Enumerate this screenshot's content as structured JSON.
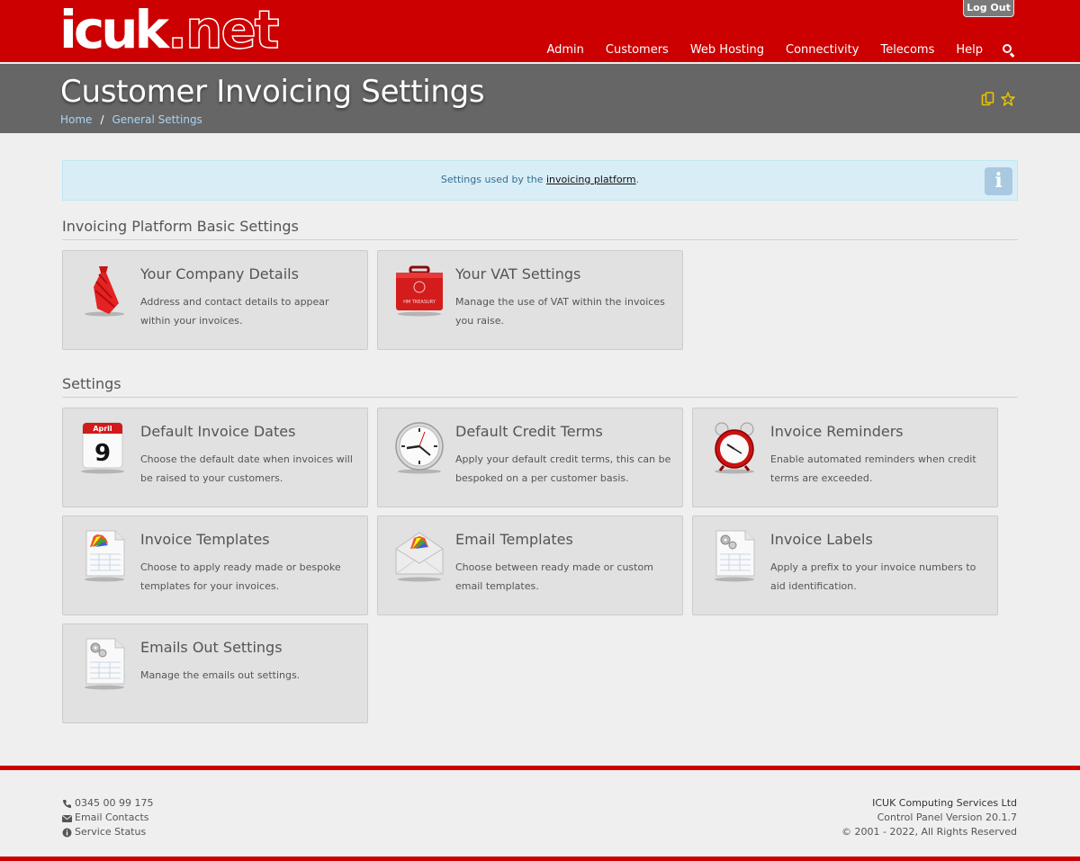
{
  "header": {
    "logo_main": "icuk",
    "logo_suffix": ".net",
    "logout_label": "Log Out",
    "nav": [
      "Admin",
      "Customers",
      "Web Hosting",
      "Connectivity",
      "Telecoms",
      "Help"
    ],
    "search_icon": "search-icon",
    "brand_color": "#cc0000"
  },
  "titlebar": {
    "title": "Customer Invoicing Settings",
    "breadcrumb": [
      "Home",
      "General Settings"
    ],
    "breadcrumb_separator": "/",
    "icons": [
      "copy-icon",
      "star-icon"
    ]
  },
  "info": {
    "text_before": "Settings used by the ",
    "link": "invoicing platform",
    "text_after": ".",
    "icon": "info-icon"
  },
  "sections": [
    {
      "heading": "Invoicing Platform Basic Settings",
      "cards": [
        {
          "title": "Your Company Details",
          "desc": "Address and contact details to appear within your invoices.",
          "icon": "tie-icon"
        },
        {
          "title": "Your VAT Settings",
          "desc": "Manage the use of VAT within the invoices you raise.",
          "icon": "treasury-case-icon",
          "icon_label": "HM TREASURY"
        }
      ]
    },
    {
      "heading": "Settings",
      "cards": [
        {
          "title": "Default Invoice Dates",
          "desc": "Choose the default date when invoices will be raised to your customers.",
          "icon": "calendar-icon",
          "icon_month": "April",
          "icon_day": "9"
        },
        {
          "title": "Default Credit Terms",
          "desc": "Apply your default credit terms, this can be bespoked on a per customer basis.",
          "icon": "clock-icon"
        },
        {
          "title": "Invoice Reminders",
          "desc": "Enable automated reminders when credit terms are exceeded.",
          "icon": "alarm-clock-icon"
        },
        {
          "title": "Invoice Templates",
          "desc": "Choose to apply ready made or bespoke templates for your invoices.",
          "icon": "colour-document-icon"
        },
        {
          "title": "Email Templates",
          "desc": "Choose between ready made or custom email templates.",
          "icon": "colour-envelope-icon"
        },
        {
          "title": "Invoice Labels",
          "desc": "Apply a prefix to your invoice numbers to aid identification.",
          "icon": "gear-document-icon"
        },
        {
          "title": "Emails Out Settings",
          "desc": "Manage the emails out settings.",
          "icon": "gear-document-icon"
        }
      ]
    }
  ],
  "footer": {
    "phone": "0345 00 99 175",
    "email": "Email Contacts",
    "status": "Service Status",
    "company": "ICUK Computing Services Ltd",
    "version": "Control Panel Version 20.1.7",
    "copyright": "© 2001 - 2022, All Rights Reserved"
  }
}
